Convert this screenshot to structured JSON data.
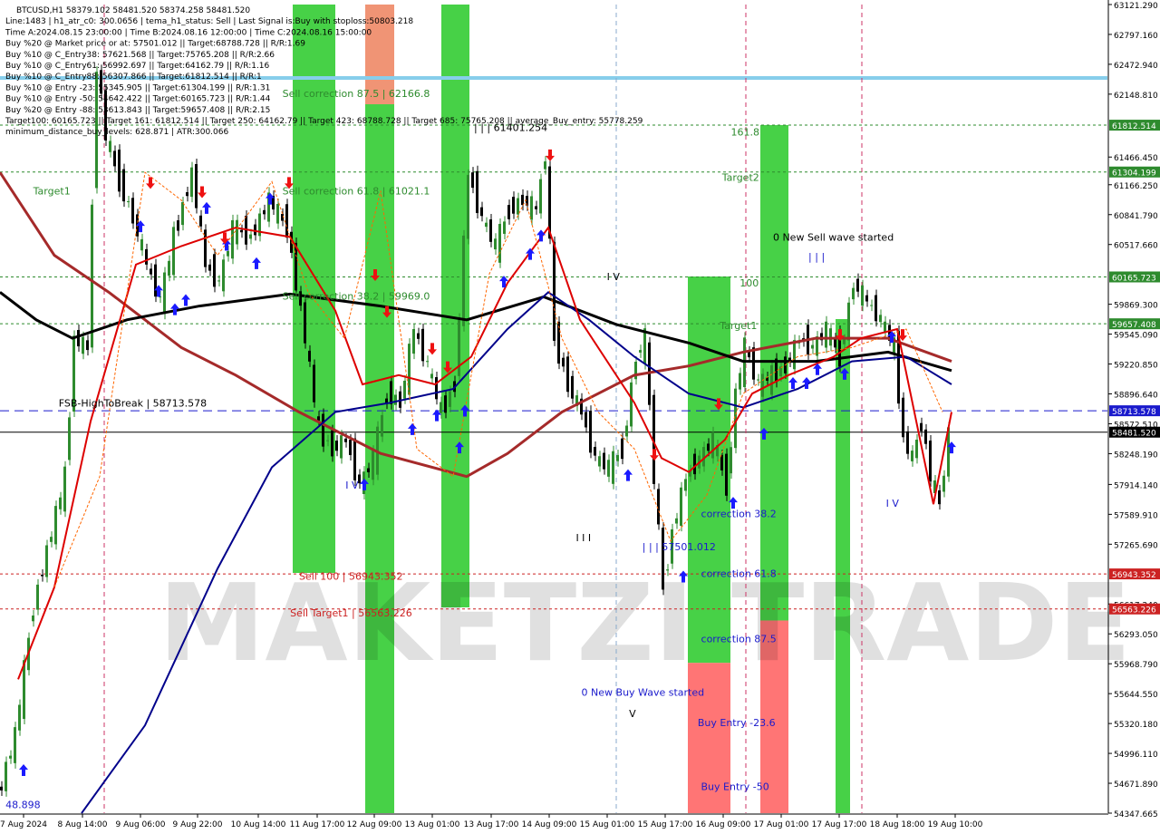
{
  "info": {
    "lines": [
      "BTCUSD,H1  58379.102 58481.520 58374.258 58481.520",
      "Line:1483 | h1_atr_c0: 300.0656 | tema_h1_status: Sell | Last Signal is:Buy with stoploss:50803.218",
      "Time A:2024.08.15 23:00:00 | Time B:2024.08.16 12:00:00 | Time C:2024.08.16 15:00:00",
      "Buy %20 @ Market price or at: 57501.012 || Target:68788.728 || R/R:1.69",
      "Buy %10 @ C_Entry38: 57621.568 || Target:75765.208 || R/R:2.66",
      "Buy %10 @ C_Entry61: 56992.697 || Target:64162.79 || R/R:1.16",
      "Buy %10 @ C_Entry88: 56307.866 || Target:61812.514 || R/R:1",
      "Buy %10 @ Entry -23: 55345.905 || Target:61304.199 || R/R:1.31",
      "Buy %10 @ Entry -50: 54642.422 || Target:60165.723 || R/R:1.44",
      "Buy %20 @ Entry -88: 53613.843 || Target:59657.408 || R/R:2.15",
      "Target100: 60165.723 || Target 161: 61812.514 || Target 250: 64162.79 || Target 423: 68788.728 || Target 685: 75765.208 || average_Buy_entry: 55778.259",
      "minimum_distance_buy_levels: 628.871 | ATR:300.066"
    ]
  },
  "chart_data": {
    "type": "line",
    "symbol": "BTCUSD,H1",
    "ylim": [
      54347.665,
      63121.29
    ],
    "y_ticks": [
      "63121.290",
      "62797.160",
      "62472.940",
      "62148.810",
      "61812.514",
      "61466.450",
      "61304.199",
      "61166.250",
      "60841.790",
      "60517.660",
      "60165.723",
      "59869.300",
      "59657.408",
      "59545.090",
      "59220.850",
      "58896.640",
      "58713.578",
      "58572.510",
      "58481.520",
      "58248.190",
      "57914.140",
      "57589.910",
      "57265.690",
      "56943.352",
      "56617.240",
      "56563.226",
      "56293.050",
      "55968.790",
      "55644.550",
      "55320.180",
      "54996.110",
      "54671.890",
      "54347.665"
    ],
    "x_ticks": [
      "7 Aug 2024",
      "8 Aug 14:00",
      "9 Aug 06:00",
      "9 Aug 22:00",
      "10 Aug 14:00",
      "11 Aug 17:00",
      "12 Aug 09:00",
      "13 Aug 01:00",
      "13 Aug 17:00",
      "14 Aug 09:00",
      "15 Aug 01:00",
      "15 Aug 17:00",
      "16 Aug 09:00",
      "17 Aug 01:00",
      "17 Aug 17:00",
      "18 Aug 18:00",
      "19 Aug 10:00"
    ],
    "current_price": 58481.52,
    "levels": [
      {
        "value": 61812.514,
        "label": "61812.514",
        "color": "#2e8b2e"
      },
      {
        "value": 61304.199,
        "label": "61304.199",
        "color": "#2e8b2e"
      },
      {
        "value": 60165.723,
        "label": "60165.723",
        "color": "#2e8b2e"
      },
      {
        "value": 59657.408,
        "label": "59657.408",
        "color": "#2e8b2e"
      },
      {
        "value": 58713.578,
        "label": "58713.578",
        "color": "#1a1acc"
      },
      {
        "value": 58481.52,
        "label": "58481.520",
        "color": "#000000"
      },
      {
        "value": 56943.352,
        "label": "56943.352",
        "color": "#cc2222"
      },
      {
        "value": 56563.226,
        "label": "56563.226",
        "color": "#cc2222"
      }
    ],
    "annotations": [
      {
        "text": "Target1",
        "x": 0.03,
        "y": 61060,
        "color": "#2e8b2e"
      },
      {
        "text": "Sell correction 87.5 | 62166.8",
        "x": 0.255,
        "y": 62120,
        "color": "#2e8b2e"
      },
      {
        "text": "Sell correction 61.8 | 61021.1",
        "x": 0.255,
        "y": 61060,
        "color": "#2e8b2e"
      },
      {
        "text": "Sell correction 38.2 | 59969.0",
        "x": 0.255,
        "y": 59920,
        "color": "#2e8b2e"
      },
      {
        "text": "| | | 61401.254",
        "x": 0.428,
        "y": 61750,
        "color": "#000000"
      },
      {
        "text": "161.8",
        "x": 0.66,
        "y": 61700,
        "color": "#2e8b2e"
      },
      {
        "text": "Target2",
        "x": 0.652,
        "y": 61210,
        "color": "#2e8b2e"
      },
      {
        "text": "0 New Sell wave started",
        "x": 0.698,
        "y": 60560,
        "color": "#000000"
      },
      {
        "text": "| | |",
        "x": 0.73,
        "y": 60350,
        "color": "#1a1acc"
      },
      {
        "text": "I V",
        "x": 0.548,
        "y": 60130,
        "color": "#000000"
      },
      {
        "text": "100",
        "x": 0.668,
        "y": 60060,
        "color": "#2e8b2e"
      },
      {
        "text": "Target1",
        "x": 0.65,
        "y": 59600,
        "color": "#2e8b2e"
      },
      {
        "text": "FSB-HighToBreak | 58713.578",
        "x": 0.053,
        "y": 58760,
        "color": "#000000"
      },
      {
        "text": "I V",
        "x": 0.312,
        "y": 57870,
        "color": "#1a1acc"
      },
      {
        "text": "correction 38.2",
        "x": 0.633,
        "y": 57560,
        "color": "#1a1acc"
      },
      {
        "text": "I I I",
        "x": 0.52,
        "y": 57300,
        "color": "#000000"
      },
      {
        "text": "| | | 57501.012",
        "x": 0.58,
        "y": 57200,
        "color": "#1a1acc"
      },
      {
        "text": "Sell 100 | 56943.352",
        "x": 0.27,
        "y": 56880,
        "color": "#cc2222"
      },
      {
        "text": "correction 61.8",
        "x": 0.633,
        "y": 56910,
        "color": "#1a1acc"
      },
      {
        "text": "Sell Target1 | 56563.226",
        "x": 0.262,
        "y": 56480,
        "color": "#cc2222"
      },
      {
        "text": "correction 87.5",
        "x": 0.633,
        "y": 56200,
        "color": "#1a1acc"
      },
      {
        "text": "0 New Buy Wave started",
        "x": 0.525,
        "y": 55620,
        "color": "#1a1acc"
      },
      {
        "text": "V",
        "x": 0.568,
        "y": 55390,
        "color": "#000000"
      },
      {
        "text": "Buy Entry -23.6",
        "x": 0.63,
        "y": 55290,
        "color": "#1a1acc"
      },
      {
        "text": "I V",
        "x": 0.8,
        "y": 57670,
        "color": "#1a1acc"
      },
      {
        "text": "Buy Entry -50",
        "x": 0.633,
        "y": 54600,
        "color": "#1a1acc"
      },
      {
        "text": "48.898",
        "x": 0.005,
        "y": 54400,
        "color": "#1a1acc"
      }
    ],
    "watermark": "MAKETZI TRADE",
    "colors": {
      "bg": "#ffffff",
      "up": "#2e8b2e",
      "down": "#000000",
      "ema": "#dd0000",
      "ma_black": "#000000",
      "ma_brown": "#a52a2a",
      "ma_navy": "#00008b",
      "ghost": "#ff6600",
      "zone_green": "#33cc33",
      "zone_red": "#ff6666",
      "hline": "#87ceeb"
    }
  }
}
